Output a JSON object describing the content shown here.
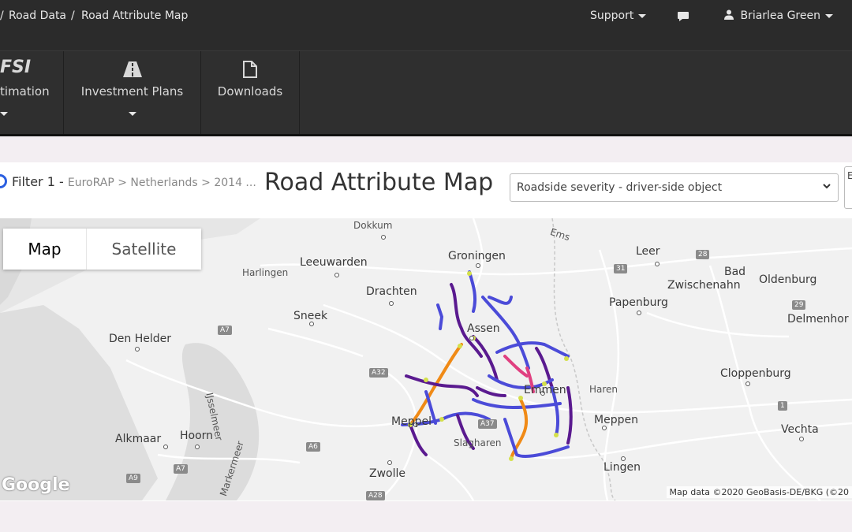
{
  "breadcrumb": {
    "item1": "Road Data",
    "item2": "Road Attribute Map"
  },
  "topnav": {
    "support": "Support",
    "user": "Briarlea Green"
  },
  "nav": {
    "item1_label": "timation",
    "logo_text": "FSI",
    "item2_label": "Investment Plans",
    "item3_label": "Downloads"
  },
  "filter": {
    "label": "Filter 1 -",
    "path": "EuroRAP > Netherlands > 2014 ..."
  },
  "page_title": "Road Attribute Map",
  "select": {
    "value": "Roadside severity - driver-side object"
  },
  "map": {
    "type_map": "Map",
    "type_satellite": "Satellite",
    "attribution": "Map data ©2020 GeoBasis-DE/BKG (©20",
    "logo": "Google",
    "places": {
      "dokkum": "Dokkum",
      "leeuwarden": "Leeuwarden",
      "harlingen": "Harlingen",
      "groningen": "Groningen",
      "drachten": "Drachten",
      "sneek": "Sneek",
      "den_helder": "Den Helder",
      "assen": "Assen",
      "ijsselmeer": "IJsselmeer",
      "emmen": "Emmen",
      "meppel": "Meppel",
      "alkmaar": "Alkmaar",
      "hoorn": "Hoorn",
      "slagharen": "Slagharen",
      "zwolle": "Zwolle",
      "markermeer": "Markermeer",
      "leer": "Leer",
      "bad_zwischenahn_1": "Bad",
      "bad_zwischenahn_2": "Zwischenahn",
      "oldenburg": "Oldenburg",
      "papenburg": "Papenburg",
      "delmenhorst": "Delmenhor",
      "cloppenburg": "Cloppenburg",
      "haren": "Haren",
      "meppen": "Meppen",
      "vechta": "Vechta",
      "lingen": "Lingen",
      "ems": "Ems"
    },
    "shields": {
      "a7_1": "A7",
      "a7_2": "A7",
      "a32": "A32",
      "a37": "A37",
      "a6": "A6",
      "a9": "A9",
      "a28": "A28",
      "r28": "28",
      "r31": "31",
      "r29": "29",
      "r1": "1"
    },
    "colors": {
      "low": "#4b4bd8",
      "mid": "#5a1a8f",
      "high": "#f08a16",
      "peak": "#e04080",
      "accent_yellow": "#d4e04a"
    }
  }
}
